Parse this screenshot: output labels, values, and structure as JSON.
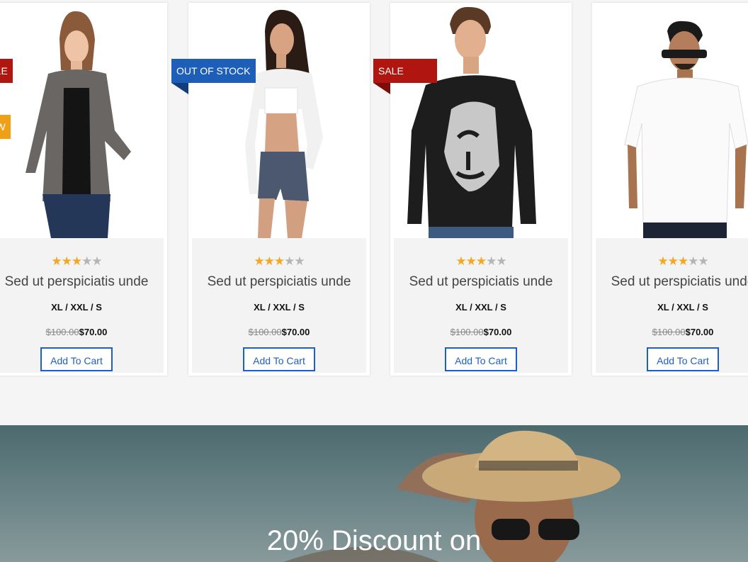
{
  "products": [
    {
      "name": "Sed ut perspiciatis unde",
      "sizes": "XL / XXL / S",
      "old_price": "$100.00",
      "price": "$70.00",
      "rating": 2.5,
      "cart_label": "Add To Cart",
      "badges": [
        "SALE",
        "NEW"
      ],
      "image": "woman-grey-cardigan"
    },
    {
      "name": "Sed ut perspiciatis unde",
      "sizes": "XL / XXL / S",
      "old_price": "$100.00",
      "price": "$70.00",
      "rating": 2.5,
      "cart_label": "Add To Cart",
      "badges": [
        "OUT OF STOCK"
      ],
      "image": "woman-white-shrug"
    },
    {
      "name": "Sed ut perspiciatis unde",
      "sizes": "XL / XXL / S",
      "old_price": "$100.00",
      "price": "$70.00",
      "rating": 2.5,
      "cart_label": "Add To Cart",
      "badges": [
        "SALE"
      ],
      "image": "man-black-tshirt"
    },
    {
      "name": "Sed ut perspiciatis unde",
      "sizes": "XL / XXL / S",
      "old_price": "$100.00",
      "price": "$70.00",
      "rating": 2.5,
      "cart_label": "Add To Cart",
      "badges": [],
      "image": "man-white-shirt"
    }
  ],
  "banner": {
    "text": "20% Discount on",
    "image": "woman-straw-hat"
  },
  "colors": {
    "sale": "#b0150f",
    "new": "#f0a017",
    "out_of_stock": "#1d5fb8",
    "button": "#1f5fbf",
    "star": "#f5a623"
  }
}
